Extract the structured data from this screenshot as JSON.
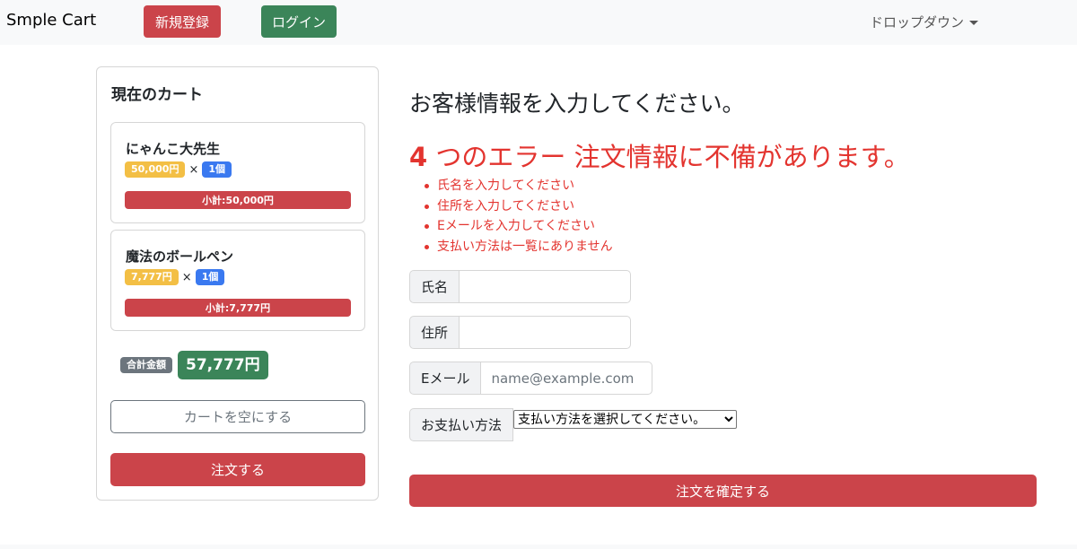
{
  "navbar": {
    "brand": "Smple Cart",
    "register_label": "新規登録",
    "login_label": "ログイン",
    "dropdown_label": "ドロップダウン"
  },
  "cart": {
    "title": "現在のカート",
    "items": [
      {
        "name": "にゃんこ大先生",
        "price": "50,000円",
        "times": "×",
        "qty": "1個",
        "subtotal": "小計:50,000円"
      },
      {
        "name": "魔法のボールペン",
        "price": "7,777円",
        "times": "×",
        "qty": "1個",
        "subtotal": "小計:7,777円"
      }
    ],
    "total_label": "合計金額",
    "total": "57,777円",
    "empty_label": "カートを空にする",
    "order_label": "注文する"
  },
  "form": {
    "title": "お客様情報を入力してください。",
    "error_count": "4",
    "error_title": " つのエラー 注文情報に不備があります。",
    "errors": [
      "氏名を入力してください",
      "住所を入力してください",
      "Eメールを入力してください",
      "支払い方法は一覧にありません"
    ],
    "name_label": "氏名",
    "name_value": "",
    "address_label": "住所",
    "address_value": "",
    "email_label": "Eメール",
    "email_placeholder": "name@example.com",
    "payment_label": "お支払い方法",
    "payment_selected": "支払い方法を選択してください。",
    "confirm_label": "注文を確定する"
  },
  "colors": {
    "danger": "#cb444a",
    "success": "#3b8559",
    "warning": "#f3bf45",
    "primary": "#3a79f0",
    "secondary": "#6c757d",
    "error_text": "#e3342f"
  }
}
